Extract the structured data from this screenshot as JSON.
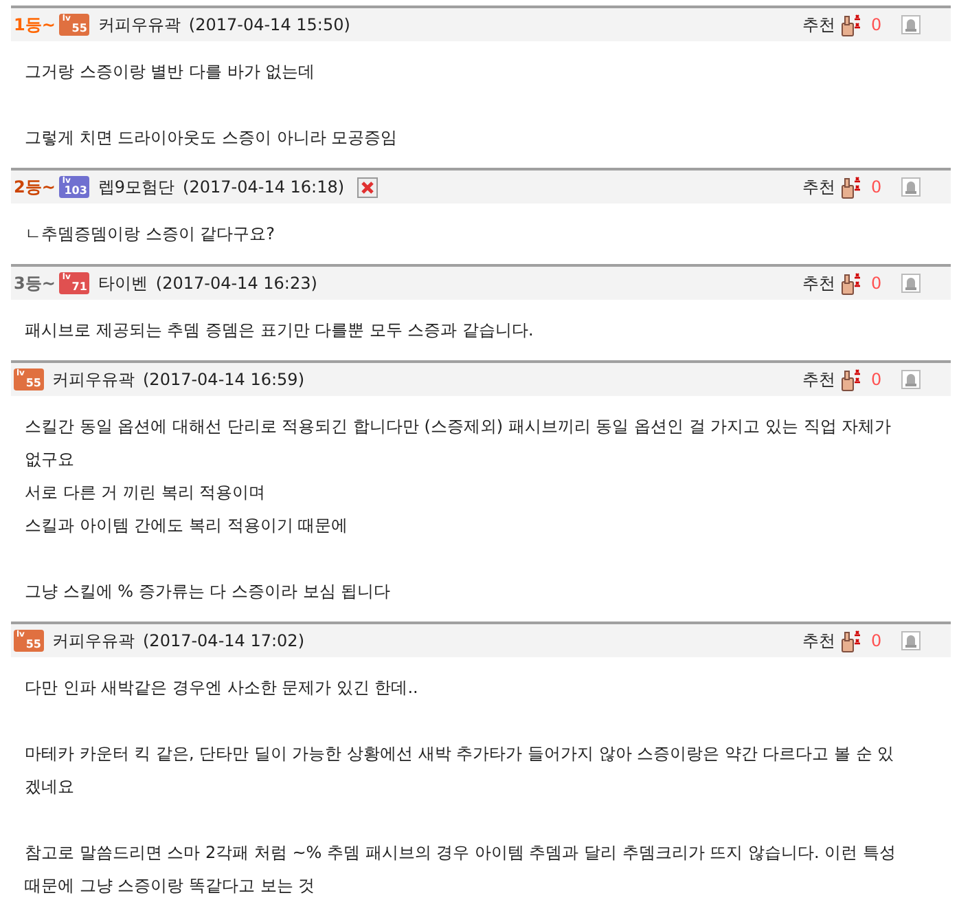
{
  "comments": [
    {
      "rank": {
        "text": "1등~",
        "color": "#ff6600"
      },
      "level": {
        "label": "lv",
        "number": "55",
        "color": "#e07040"
      },
      "author": "커피우유곽",
      "time": "(2017-04-14 15:50)",
      "deletable": false,
      "recommend_label": "추천",
      "recommend_count": "0",
      "paragraphs": [
        [
          "그거랑 스증이랑 별반 다를 바가 없는데"
        ],
        [
          "그렇게 치면 드라이아웃도 스증이 아니라 모공증임"
        ]
      ]
    },
    {
      "rank": {
        "text": "2등~",
        "color": "#cc4400"
      },
      "level": {
        "label": "lv",
        "number": "103",
        "color": "#7070d0"
      },
      "author": "렙9모험단",
      "time": "(2017-04-14 16:18)",
      "deletable": true,
      "recommend_label": "추천",
      "recommend_count": "0",
      "paragraphs": [
        [
          "ㄴ추뎀증뎀이랑 스증이 같다구요?"
        ]
      ]
    },
    {
      "rank": {
        "text": "3등~",
        "color": "#666666"
      },
      "level": {
        "label": "lv",
        "number": "71",
        "color": "#e05050"
      },
      "author": "타이벤",
      "time": "(2017-04-14 16:23)",
      "deletable": false,
      "recommend_label": "추천",
      "recommend_count": "0",
      "paragraphs": [
        [
          "패시브로 제공되는 추뎀 증뎀은 표기만 다를뿐 모두 스증과 같습니다."
        ]
      ]
    },
    {
      "level": {
        "label": "lv",
        "number": "55",
        "color": "#e07040"
      },
      "author": "커피우유곽",
      "time": "(2017-04-14 16:59)",
      "deletable": false,
      "recommend_label": "추천",
      "recommend_count": "0",
      "paragraphs": [
        [
          "스킬간 동일 옵션에 대해선 단리로 적용되긴 합니다만 (스증제외) 패시브끼리 동일 옵션인 걸 가지고 있는 직업 자체가",
          "없구요",
          "서로 다른 거 끼린 복리 적용이며",
          "스킬과 아이템 간에도 복리 적용이기 때문에"
        ],
        [
          "그냥 스킬에 % 증가류는 다 스증이라 보심 됩니다"
        ]
      ]
    },
    {
      "level": {
        "label": "lv",
        "number": "55",
        "color": "#e07040"
      },
      "author": "커피우유곽",
      "time": "(2017-04-14 17:02)",
      "deletable": false,
      "recommend_label": "추천",
      "recommend_count": "0",
      "paragraphs": [
        [
          "다만 인파 새박같은 경우엔 사소한 문제가 있긴 한데.."
        ],
        [
          "마테카 카운터 킥 같은, 단타만 딜이 가능한 상황에선 새박 추가타가 들어가지 않아 스증이랑은 약간 다르다고 볼 순 있",
          "겠네요"
        ],
        [
          "참고로 말씀드리면 스마 2각패 처럼 ~% 추뎀 패시브의 경우 아이템 추뎀과 달리 추뎀크리가 뜨지 않습니다. 이런 특성",
          "때문에 그냥 스증이랑 똑같다고 보는 것"
        ]
      ]
    }
  ]
}
